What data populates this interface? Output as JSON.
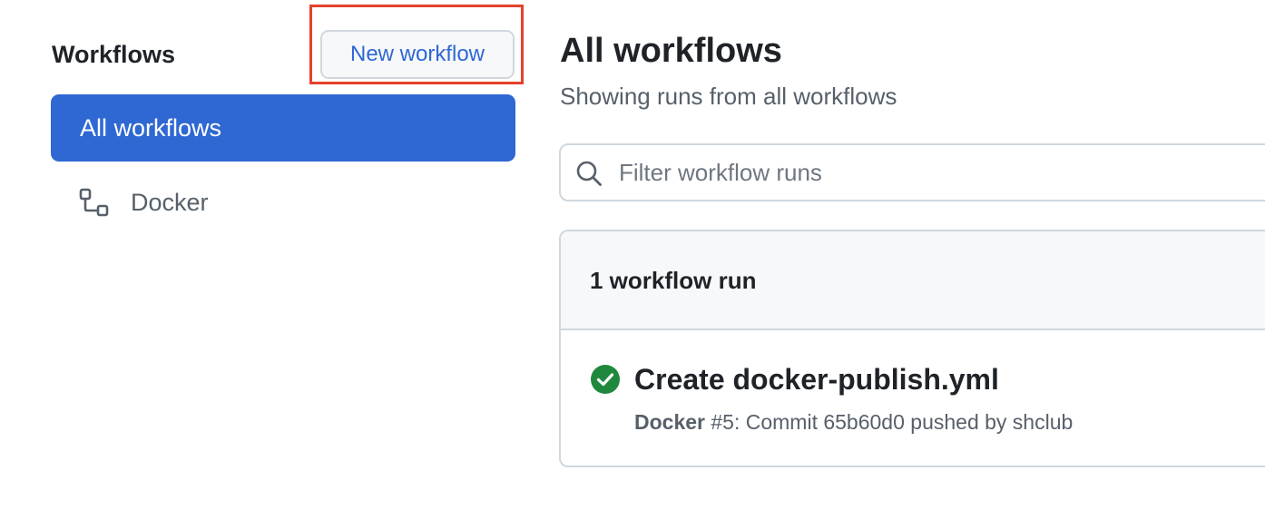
{
  "sidebar": {
    "title": "Workflows",
    "new_workflow_label": "New workflow",
    "items": [
      {
        "label": "All workflows",
        "active": true
      },
      {
        "label": "Docker",
        "icon": "workflow-icon",
        "active": false
      }
    ]
  },
  "main": {
    "title": "All workflows",
    "subtitle": "Showing runs from all workflows",
    "search": {
      "placeholder": "Filter workflow runs",
      "value": ""
    },
    "runs": {
      "count_label": "1 workflow run",
      "items": [
        {
          "status": "success",
          "status_icon": "check-circle-icon",
          "title": "Create docker-publish.yml",
          "workflow_name": "Docker",
          "run_detail": " #5: Commit 65b60d0 pushed by shclub"
        }
      ]
    }
  },
  "colors": {
    "accent": "#2f68d3",
    "highlight_border": "#e5412c",
    "success": "#1f883d",
    "border": "#d0d7de",
    "muted_text": "#57606a"
  }
}
